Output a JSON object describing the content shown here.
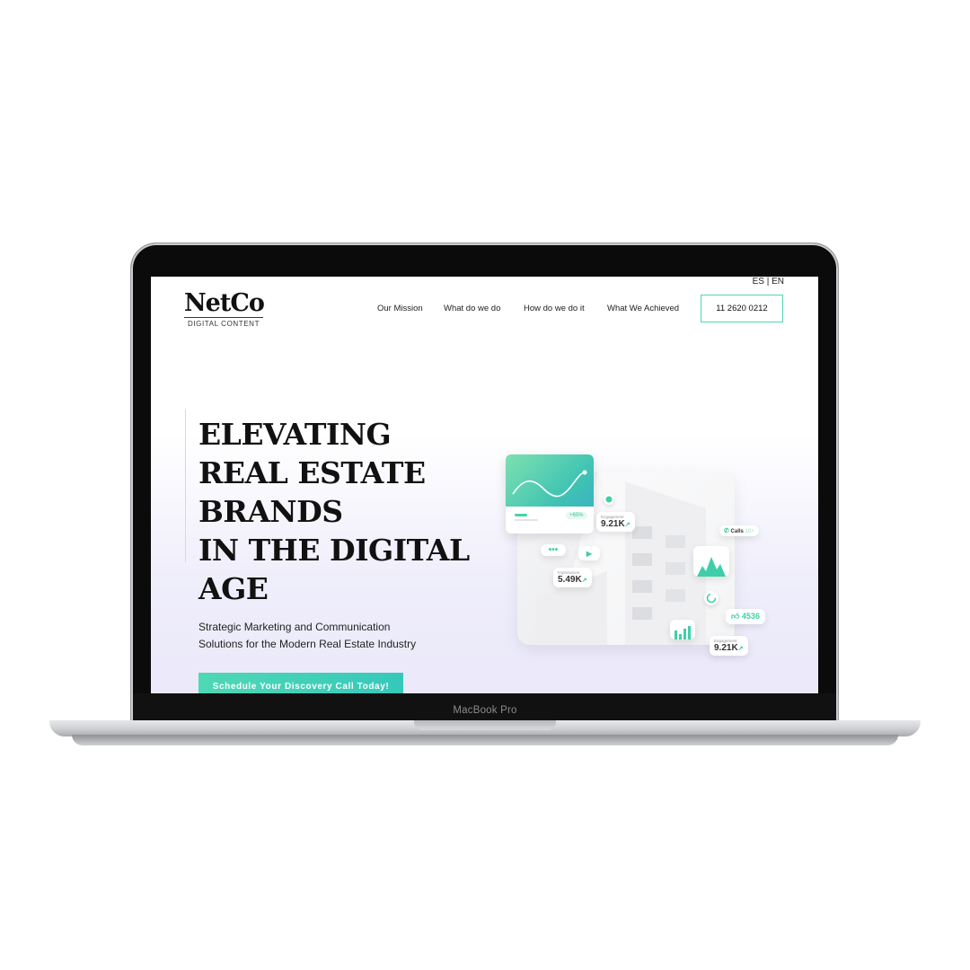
{
  "device": {
    "label": "MacBook Pro"
  },
  "header": {
    "logo": {
      "main": "NetCo",
      "sub": "DIGITAL CONTENT"
    },
    "lang": {
      "es": "ES",
      "sep": "|",
      "en": "EN"
    },
    "nav": [
      "Our Mission",
      "What do we do",
      "How do we do it",
      "What We Achieved"
    ],
    "phone": "11 2620 0212"
  },
  "hero": {
    "title_lines": [
      "ELEVATING",
      "REAL ESTATE",
      "BRANDS",
      "IN THE DIGITAL",
      "AGE"
    ],
    "subtitle_lines": [
      "Strategic Marketing and Communication",
      "Solutions for the Modern Real Estate Industry"
    ],
    "cta": "Schedule Your Discovery Call Today!"
  },
  "illustration": {
    "growth_pill": "+65%",
    "engagement_label": "Engagement",
    "engagement_value": "9.21K",
    "impressions_label": "Impressions",
    "impressions_value": "5.49K",
    "calls_label": "Calls",
    "calls_value": "10+",
    "likes_value": "4536",
    "engagement2_label": "Engagement",
    "engagement2_value": "9.21K",
    "accent": "#3fcfa8",
    "icons": [
      "heart-icon",
      "phone-icon",
      "play-icon",
      "thumbs-up-icon",
      "bar-chart-icon",
      "progress-ring-icon",
      "dots-icon"
    ]
  }
}
